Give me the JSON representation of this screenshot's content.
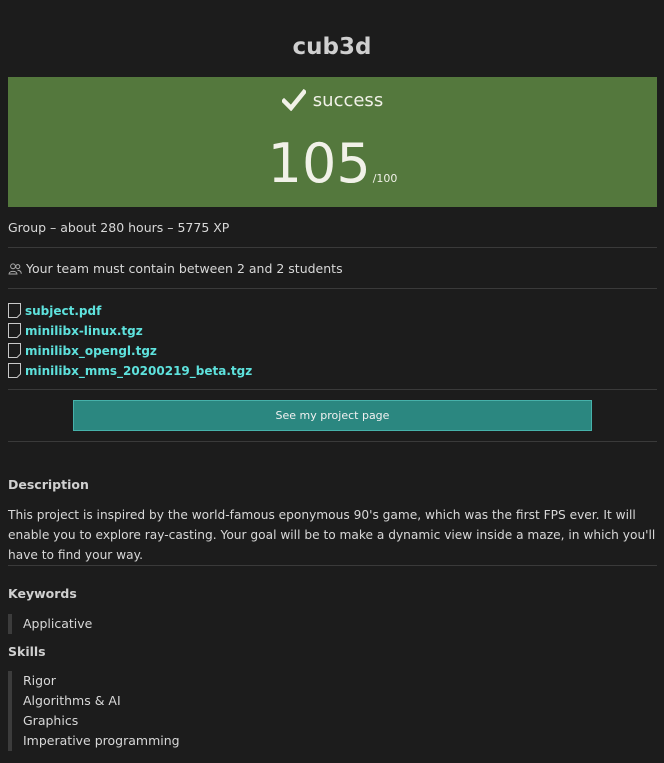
{
  "project": {
    "title": "cub3d"
  },
  "grade": {
    "status": "success",
    "mark": "105",
    "max": "/100",
    "status_color": "#54783d"
  },
  "info": {
    "summary": "Group – about 280 hours – 5775 XP",
    "team_requirement": "Your team must contain between 2 and 2 students"
  },
  "attachments": [
    {
      "name": "subject.pdf",
      "icon": "file-icon"
    },
    {
      "name": "minilibx-linux.tgz",
      "icon": "file-icon"
    },
    {
      "name": "minilibx_opengl.tgz",
      "icon": "file-icon"
    },
    {
      "name": "minilibx_mms_20200219_beta.tgz",
      "icon": "file-icon"
    }
  ],
  "actions": {
    "project_page_label": "See my project page",
    "accent_color": "#2b8780"
  },
  "description": {
    "heading": "Description",
    "text": "This project is inspired by the world-famous eponymous 90's game, which was the first FPS ever. It will enable you to explore ray-casting. Your goal will be to make a dynamic view inside a maze, in which you'll have to find your way."
  },
  "keywords": {
    "heading": "Keywords",
    "items": [
      "Applicative"
    ]
  },
  "skills": {
    "heading": "Skills",
    "items": [
      "Rigor",
      "Algorithms & AI",
      "Graphics",
      "Imperative programming"
    ]
  }
}
